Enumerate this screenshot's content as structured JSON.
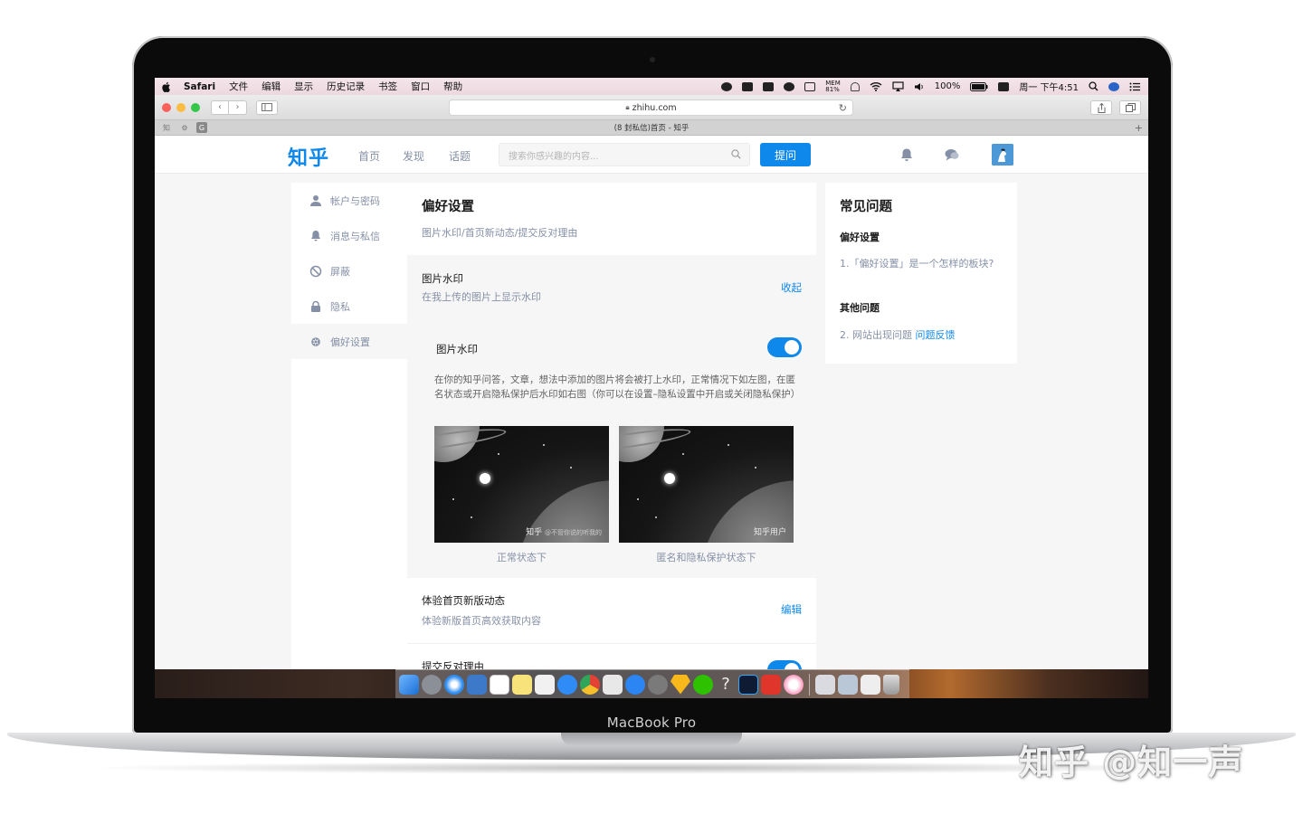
{
  "device": {
    "model_label": "MacBook Pro"
  },
  "menubar": {
    "app": "Safari",
    "items": [
      "文件",
      "编辑",
      "显示",
      "历史记录",
      "书签",
      "窗口",
      "帮助"
    ],
    "mem_label": "MEM",
    "mem_value": "81%",
    "battery": "100%",
    "clock": "周一 下午4:51"
  },
  "browser": {
    "address": "zhihu.com",
    "tab_title": "(8 封私信)首页 - 知乎",
    "favorites": [
      "知",
      "⚙",
      "G"
    ]
  },
  "header": {
    "logo": "知乎",
    "nav": [
      "首页",
      "发现",
      "话题"
    ],
    "search_placeholder": "搜索你感兴趣的内容...",
    "ask_button": "提问"
  },
  "sidebar": {
    "items": [
      {
        "label": "帐户与密码",
        "icon": "user-icon"
      },
      {
        "label": "消息与私信",
        "icon": "bell-icon"
      },
      {
        "label": "屏蔽",
        "icon": "block-icon"
      },
      {
        "label": "隐私",
        "icon": "lock-icon"
      },
      {
        "label": "偏好设置",
        "icon": "gear-icon",
        "active": true
      }
    ]
  },
  "panel": {
    "title": "偏好设置",
    "subtitle": "图片水印/首页新动态/提交反对理由",
    "watermark": {
      "title": "图片水印",
      "desc": "在我上传的图片上显示水印",
      "action": "收起",
      "toggle_label": "图片水印",
      "toggle_on": true,
      "explanation": "在你的知乎问答，文章，想法中添加的图片将会被打上水印，正常情况下如左图，在匿名状态或开启隐私保护后水印如右图（你可以在设置–隐私设置中开启或关闭隐私保护）",
      "left_watermark": "知乎",
      "left_watermark_small": "@不管你说的听我的",
      "right_watermark": "知乎用户",
      "left_caption": "正常状态下",
      "right_caption": "匿名和隐私保护状态下"
    },
    "new_feed": {
      "title": "体验首页新版动态",
      "desc": "体验新版首页高效获取内容",
      "action": "编辑"
    },
    "objection": {
      "title": "提交反对理由"
    }
  },
  "faq": {
    "title": "常见问题",
    "group1": "偏好设置",
    "item1": "1.「偏好设置」是一个怎样的板块?",
    "group2": "其他问题",
    "item2": "2. 网站出现问题",
    "item2_link": "问题反馈"
  },
  "overlay_watermark": "知乎 @知一声",
  "colors": {
    "accent": "#0f88eb",
    "muted_text": "#8590a6",
    "menubar": "#efdde3"
  }
}
